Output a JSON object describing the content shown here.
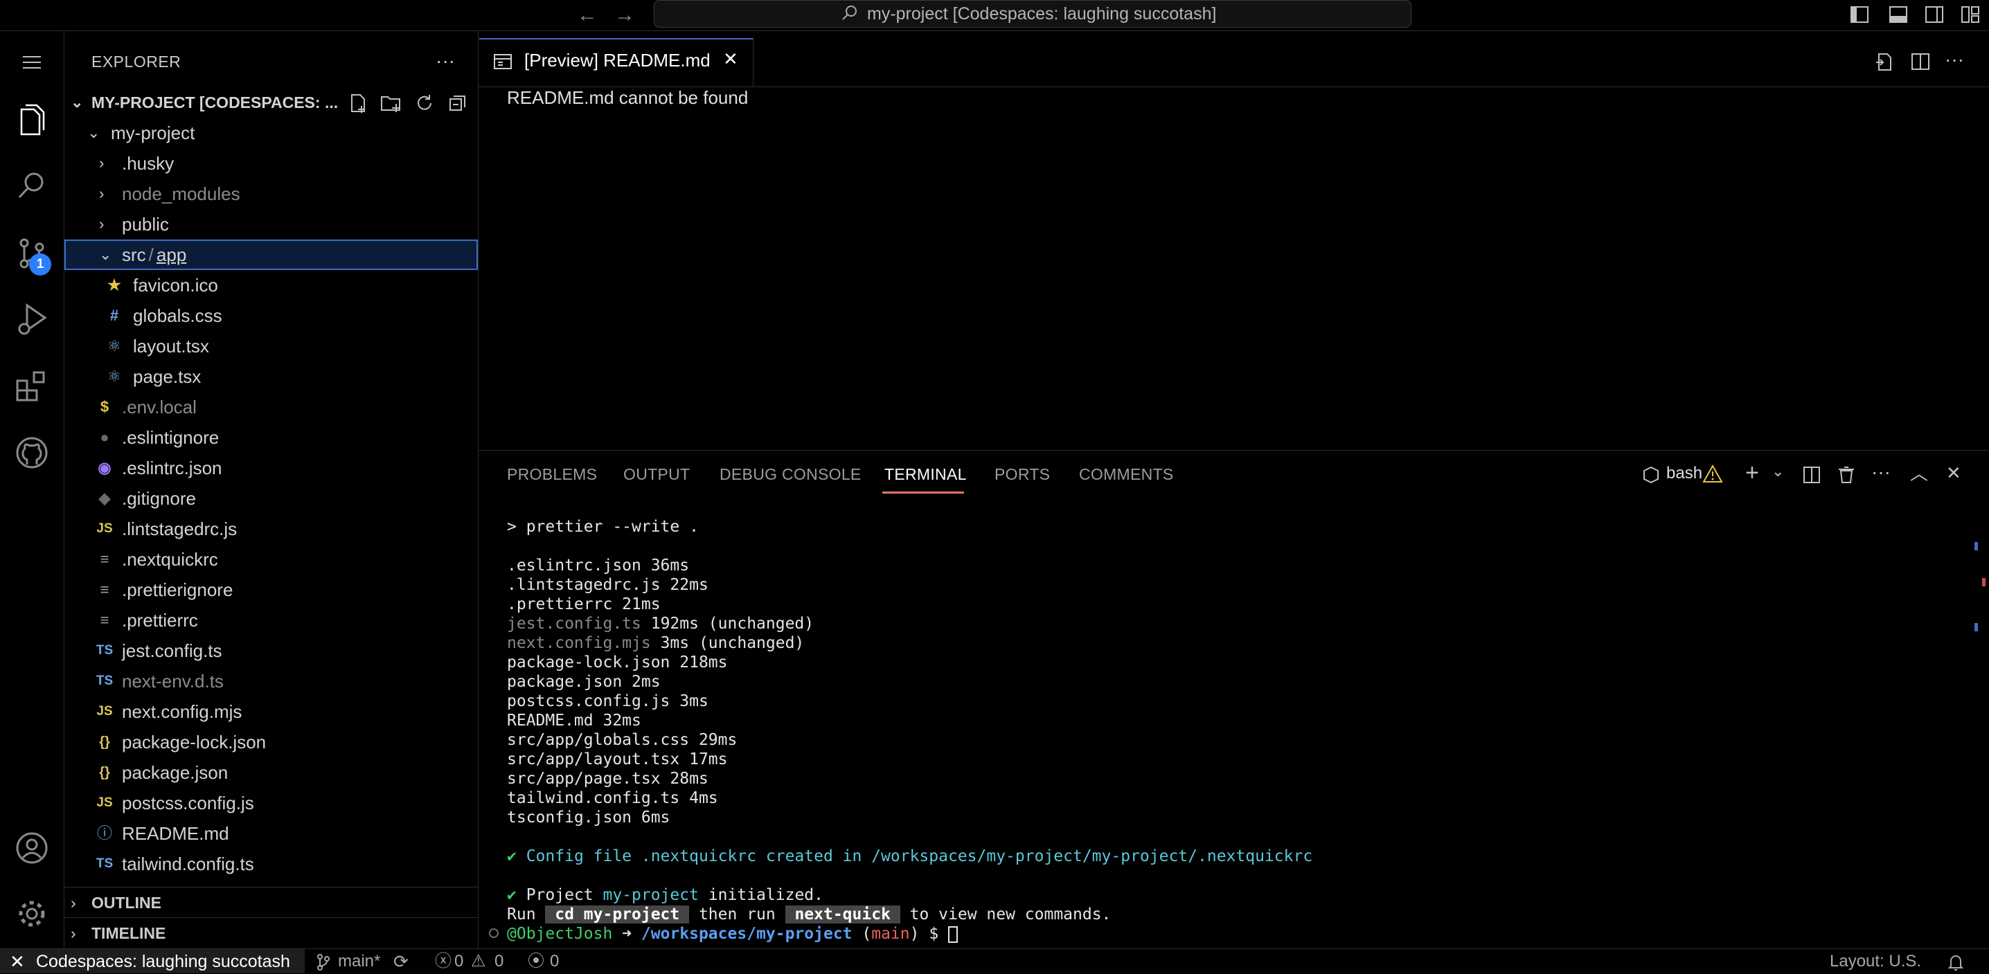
{
  "titlebar": {
    "command_center": "my-project [Codespaces: laughing succotash]"
  },
  "activity": {
    "scm_badge": "1"
  },
  "sidebar": {
    "title": "EXPLORER",
    "root": "MY-PROJECT [CODESPACES: ...",
    "items": [
      {
        "label": "my-project"
      },
      {
        "label": ".husky"
      },
      {
        "label": "node_modules"
      },
      {
        "label": "public"
      },
      {
        "label_a": "src",
        "sep": "/",
        "label_b": "app"
      },
      {
        "label": "favicon.ico",
        "icon": "★"
      },
      {
        "label": "globals.css",
        "icon": "#"
      },
      {
        "label": "layout.tsx",
        "icon": "⚛"
      },
      {
        "label": "page.tsx",
        "icon": "⚛"
      },
      {
        "label": ".env.local",
        "icon": "$"
      },
      {
        "label": ".eslintignore",
        "icon": "●"
      },
      {
        "label": ".eslintrc.json",
        "icon": "◉"
      },
      {
        "label": ".gitignore",
        "icon": "◆"
      },
      {
        "label": ".lintstagedrc.js",
        "icon": "JS"
      },
      {
        "label": ".nextquickrc",
        "icon": "≡"
      },
      {
        "label": ".prettierignore",
        "icon": "≡"
      },
      {
        "label": ".prettierrc",
        "icon": "≡"
      },
      {
        "label": "jest.config.ts",
        "icon": "TS"
      },
      {
        "label": "next-env.d.ts",
        "icon": "TS"
      },
      {
        "label": "next.config.mjs",
        "icon": "JS"
      },
      {
        "label": "package-lock.json",
        "icon": "{}"
      },
      {
        "label": "package.json",
        "icon": "{}"
      },
      {
        "label": "postcss.config.js",
        "icon": "JS"
      },
      {
        "label": "README.md",
        "icon": "ⓘ"
      },
      {
        "label": "tailwind.config.ts",
        "icon": "TS"
      }
    ],
    "sections": {
      "outline": "OUTLINE",
      "timeline": "TIMELINE"
    }
  },
  "editor": {
    "tab_label": "[Preview] README.md",
    "message": "README.md cannot be found"
  },
  "panel": {
    "tabs": [
      "PROBLEMS",
      "OUTPUT",
      "DEBUG CONSOLE",
      "TERMINAL",
      "PORTS",
      "COMMENTS"
    ],
    "terminal_name": "bash",
    "lines": {
      "l0": "> prettier --write .",
      "l1": ".eslintrc.json 36ms",
      "l2": ".lintstagedrc.js 22ms",
      "l3": ".prettierrc 21ms",
      "l4a": "jest.config.ts",
      "l4b": " 192ms (unchanged)",
      "l5a": "next.config.mjs",
      "l5b": " 3ms (unchanged)",
      "l6": "package-lock.json 218ms",
      "l7": "package.json 2ms",
      "l8": "postcss.config.js 3ms",
      "l9": "README.md 32ms",
      "l10": "src/app/globals.css 29ms",
      "l11": "src/app/layout.tsx 17ms",
      "l12": "src/app/page.tsx 28ms",
      "l13": "tailwind.config.ts 4ms",
      "l14": "tsconfig.json 6ms",
      "l15a": "✔ ",
      "l15b": "Config file .nextquickrc created in /workspaces/my-project/my-project/.nextquickrc",
      "l16a": "✔ ",
      "l16b": "Project ",
      "l16c": "my-project",
      "l16d": " initialized.",
      "l17a": "Run ",
      "l17b": " cd my-project ",
      "l17c": " then run ",
      "l17d": " next-quick ",
      "l17e": " to view new commands.",
      "p_user": "@ObjectJosh",
      "p_arrow": " ➜ ",
      "p_path": "/workspaces/my-project",
      "p_open": " (",
      "p_branch": "main",
      "p_close": ")",
      "p_dollar": " $ "
    }
  },
  "statusbar": {
    "remote": "Codespaces: laughing succotash",
    "branch": "main*",
    "errors": "0",
    "warnings": "0",
    "ports": "0",
    "layout": "Layout: U.S."
  }
}
